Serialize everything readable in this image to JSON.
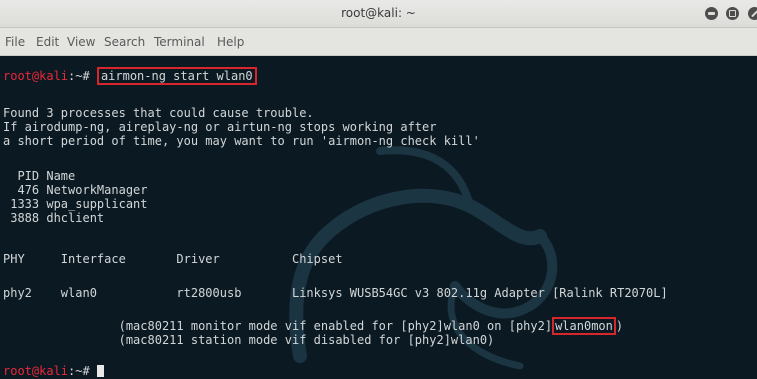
{
  "window": {
    "title": "root@kali: ~"
  },
  "menu": {
    "items": [
      "File",
      "Edit",
      "View",
      "Search",
      "Terminal",
      "Help"
    ]
  },
  "terminal": {
    "prompt_user": "root@kali",
    "prompt_path": ":~# ",
    "command": "airmon-ng start wlan0",
    "warning_lines": [
      "Found 3 processes that could cause trouble.",
      "If airodump-ng, aireplay-ng or airtun-ng stops working after",
      "a short period of time, you may want to run 'airmon-ng check kill'"
    ],
    "process_header": "  PID Name",
    "processes": [
      "  476 NetworkManager",
      " 1333 wpa_supplicant",
      " 3888 dhclient"
    ],
    "iface_header": "PHY     Interface       Driver          Chipset",
    "iface_row": "phy2    wlan0           rt2800usb       Linksys WUSB54GC v3 802.11g Adapter [Ralink RT2070L]",
    "monitor_prefix": "                (mac80211 monitor mode vif enabled for [phy2]wlan0 on [phy2]",
    "monitor_iface": "wlan0mon",
    "monitor_suffix": ")",
    "station_line": "                (mac80211 station mode vif disabled for [phy2]wlan0)",
    "final_prompt_path": ":~# "
  }
}
